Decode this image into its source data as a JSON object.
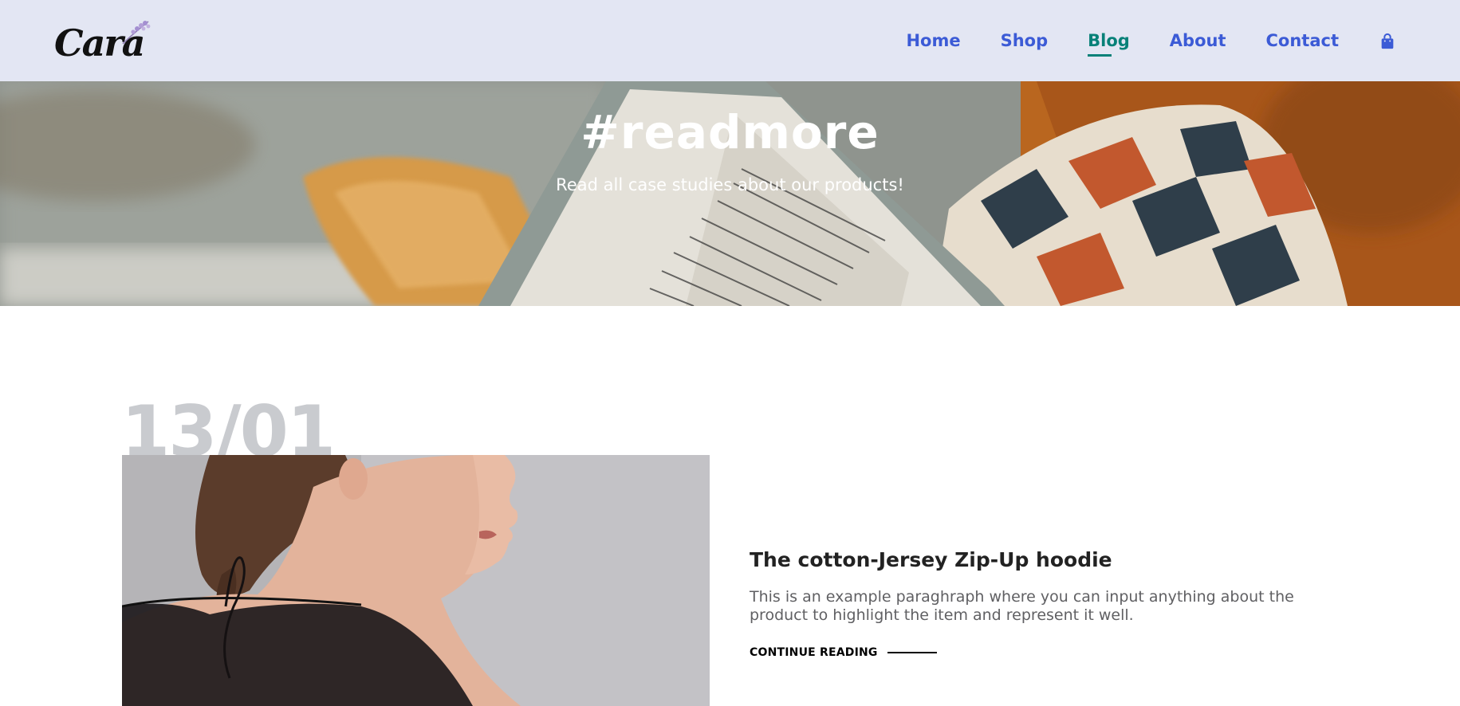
{
  "header": {
    "logo_text": "Cara",
    "nav": [
      {
        "label": "Home",
        "active": false
      },
      {
        "label": "Shop",
        "active": false
      },
      {
        "label": "Blog",
        "active": true
      },
      {
        "label": "About",
        "active": false
      },
      {
        "label": "Contact",
        "active": false
      }
    ],
    "cart_icon": "shopping-bag-icon"
  },
  "hero": {
    "title": "#readmore",
    "subtitle": "Read all case studies about our products!"
  },
  "post": {
    "date": "13/01",
    "title": "The cotton-Jersey Zip-Up hoodie",
    "text": "This is an example paraghraph where you can input anything about the product to highlight the item and represent it well.",
    "link_label": "CONTINUE READING"
  },
  "colors": {
    "header_bg": "#e3e6f3",
    "nav_link": "#3c5bd6",
    "nav_active": "#088178",
    "date_text": "#c9cbcf"
  }
}
